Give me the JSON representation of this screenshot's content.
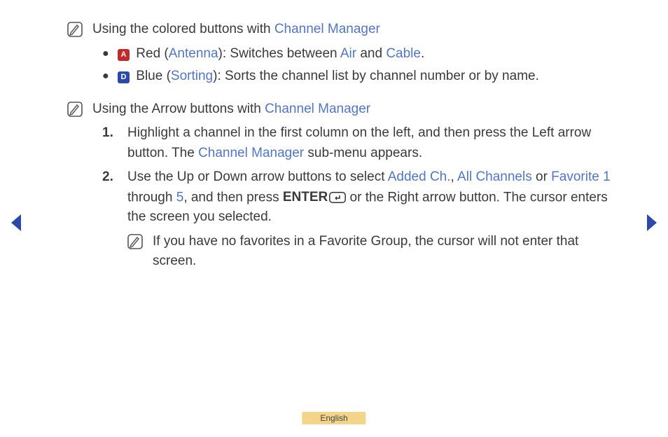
{
  "section1": {
    "lead_pre": "Using the colored buttons with ",
    "lead_link": "Channel Manager",
    "bullets": [
      {
        "key_letter": "A",
        "key_color": "red",
        "pre": " Red (",
        "link1": "Antenna",
        "mid1": "): Switches between ",
        "link2": "Air",
        "mid2": " and ",
        "link3": "Cable",
        "tail": "."
      },
      {
        "key_letter": "D",
        "key_color": "blue",
        "pre": " Blue (",
        "link1": "Sorting",
        "mid1": "): Sorts the channel list by channel number or by name.",
        "link2": "",
        "mid2": "",
        "link3": "",
        "tail": ""
      }
    ]
  },
  "section2": {
    "lead_pre": "Using the Arrow buttons with ",
    "lead_link": "Channel Manager",
    "step1": {
      "num": "1.",
      "pre": "Highlight a channel in the first column on the left, and then press the Left arrow button. The ",
      "link": "Channel Manager",
      "tail": " sub-menu appears."
    },
    "step2": {
      "num": "2.",
      "pre": "Use the Up or Down arrow buttons to select ",
      "link1": "Added Ch.",
      "mid1": ", ",
      "link2": "All Channels",
      "mid2": " or ",
      "link3": "Favorite 1",
      "mid3": " through ",
      "link4": "5",
      "mid4": ", and then press ",
      "enter": "ENTER",
      "mid5": " or the Right arrow button. The cursor enters the screen you selected."
    },
    "subnote": "If you have no favorites in a Favorite Group, the cursor will not enter that screen."
  },
  "language": "English"
}
